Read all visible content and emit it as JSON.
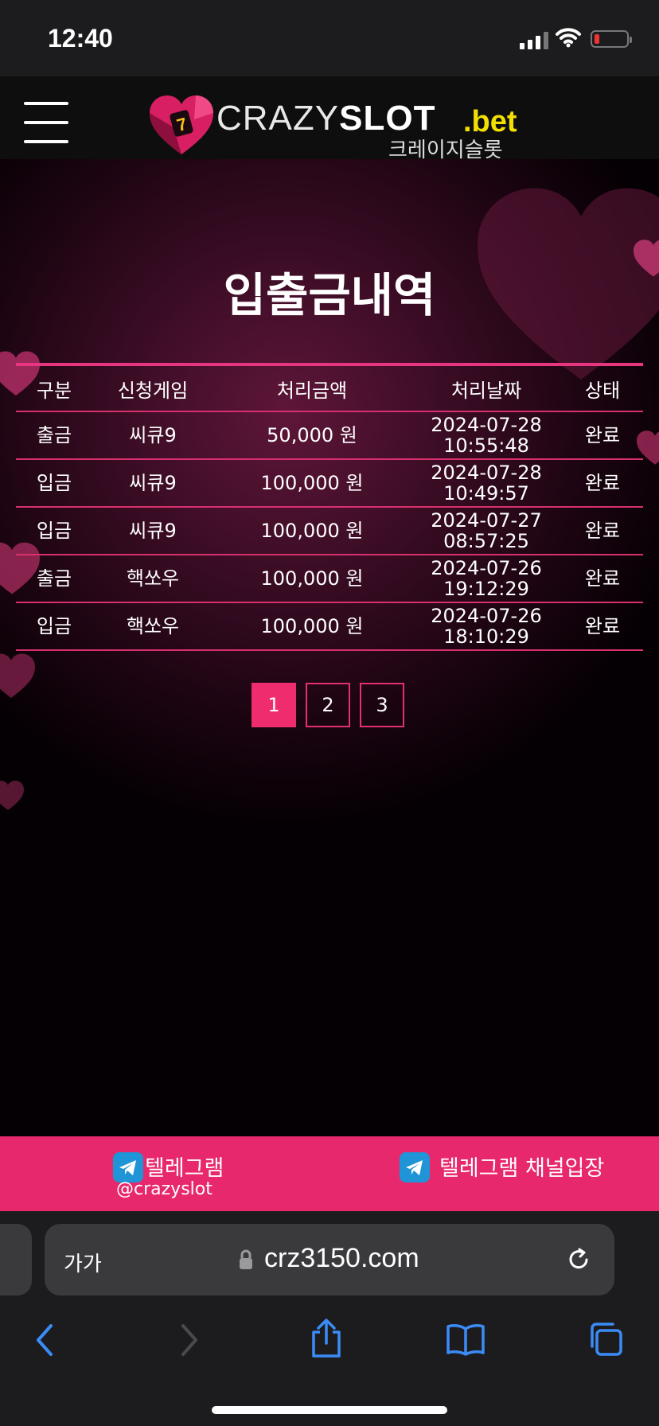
{
  "status": {
    "time": "12:40"
  },
  "header": {
    "logo_light": "CRAZY",
    "logo_bold": "SLOT",
    "logo_tld": ".bet",
    "logo_korean": "크레이지슬롯"
  },
  "page": {
    "title": "입출금내역"
  },
  "table": {
    "headers": [
      "구분",
      "신청게임",
      "처리금액",
      "처리날짜",
      "상태"
    ],
    "rows": [
      {
        "type": "출금",
        "game": "씨큐9",
        "amount": "50,000 원",
        "date": "2024-07-28",
        "time": "10:55:48",
        "status": "완료"
      },
      {
        "type": "입금",
        "game": "씨큐9",
        "amount": "100,000 원",
        "date": "2024-07-28",
        "time": "10:49:57",
        "status": "완료"
      },
      {
        "type": "입금",
        "game": "씨큐9",
        "amount": "100,000 원",
        "date": "2024-07-27",
        "time": "08:57:25",
        "status": "완료"
      },
      {
        "type": "출금",
        "game": "핵쏘우",
        "amount": "100,000 원",
        "date": "2024-07-26",
        "time": "19:12:29",
        "status": "완료"
      },
      {
        "type": "입금",
        "game": "핵쏘우",
        "amount": "100,000 원",
        "date": "2024-07-26",
        "time": "18:10:29",
        "status": "완료"
      }
    ]
  },
  "pagination": {
    "pages": [
      "1",
      "2",
      "3"
    ],
    "current": "1"
  },
  "footer": {
    "telegram_label": "텔레그램",
    "telegram_handle": "@crazyslot",
    "channel_label": "텔레그램 채널입장",
    "icon": "telegram-icon"
  },
  "browser": {
    "text_size": "가가",
    "url": "crz3150.com"
  },
  "colors": {
    "accent": "#e8286c",
    "table_line": "#d8306f",
    "logo_tld": "#f2e000"
  }
}
